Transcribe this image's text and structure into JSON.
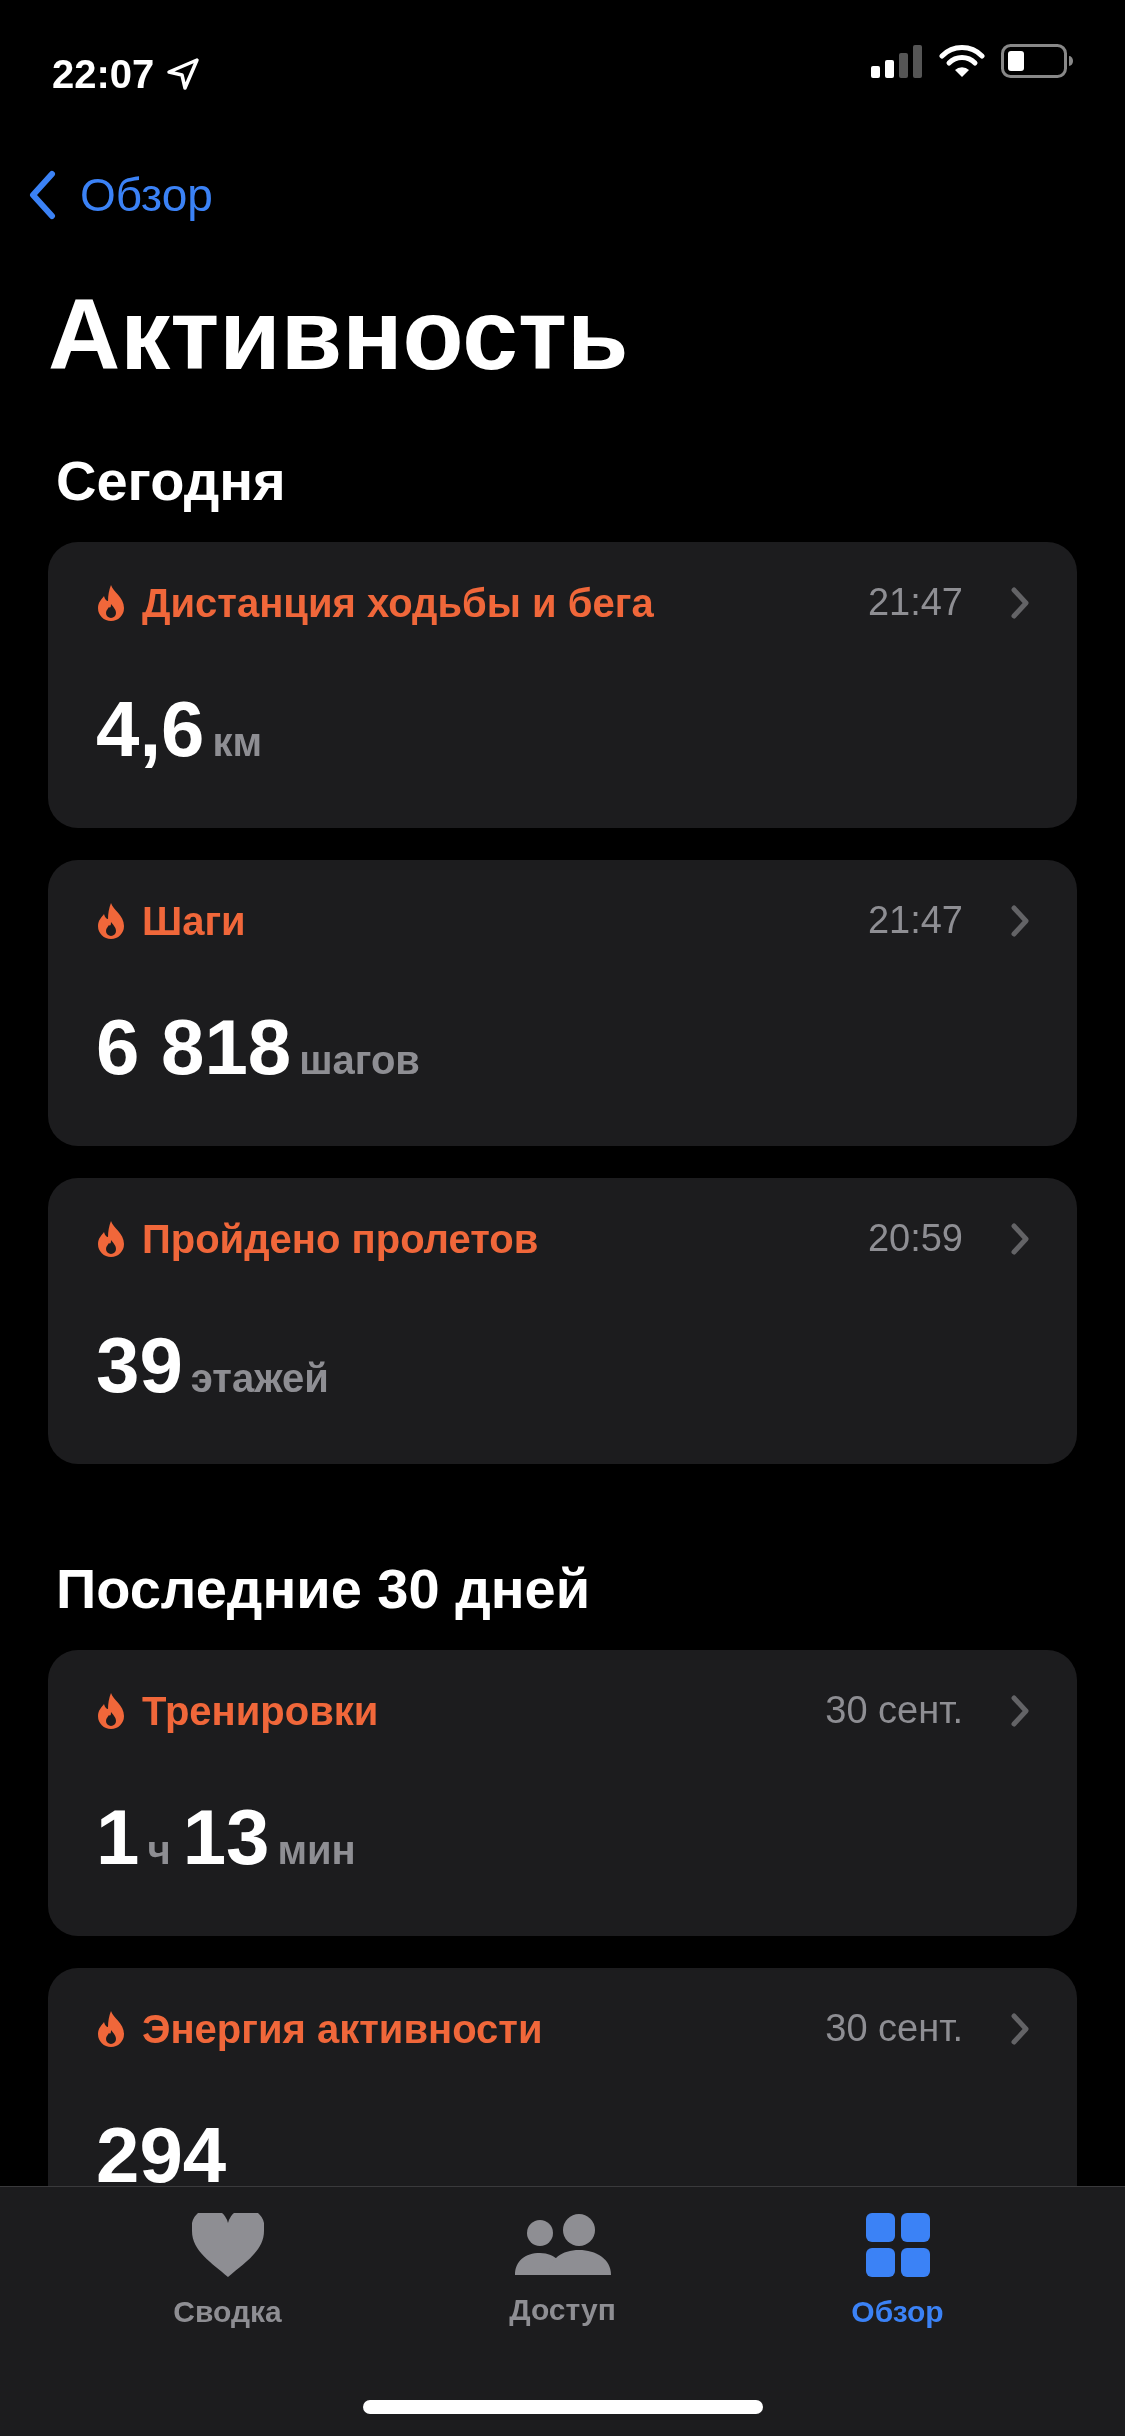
{
  "status_bar": {
    "time": "22:07"
  },
  "nav": {
    "back_label": "Обзор"
  },
  "title": "Активность",
  "sections": [
    {
      "heading": "Сегодня",
      "cards": [
        {
          "title": "Дистанция ходьбы и бега",
          "time": "21:47",
          "value": [
            {
              "kind": "number",
              "text": "4,6"
            },
            {
              "kind": "unit",
              "text": "км"
            }
          ]
        },
        {
          "title": "Шаги",
          "time": "21:47",
          "value": [
            {
              "kind": "number",
              "text": "6 818"
            },
            {
              "kind": "unit",
              "text": "шагов"
            }
          ]
        },
        {
          "title": "Пройдено пролетов",
          "time": "20:59",
          "value": [
            {
              "kind": "number",
              "text": "39"
            },
            {
              "kind": "unit",
              "text": "этажей"
            }
          ]
        }
      ]
    },
    {
      "heading": "Последние 30 дней",
      "cards": [
        {
          "title": "Тренировки",
          "time": "30 сент.",
          "value": [
            {
              "kind": "number",
              "text": "1"
            },
            {
              "kind": "unit",
              "text": "ч"
            },
            {
              "kind": "number",
              "text": "13"
            },
            {
              "kind": "unit",
              "text": "мин"
            }
          ]
        },
        {
          "title": "Энергия активности",
          "time": "30 сент.",
          "value": [
            {
              "kind": "number",
              "text": "294"
            }
          ]
        }
      ]
    }
  ],
  "tab_bar": [
    {
      "kind": "heart",
      "label": "Сводка",
      "selected": false
    },
    {
      "kind": "people",
      "label": "Доступ",
      "selected": false
    },
    {
      "kind": "grid",
      "label": "Обзор",
      "selected": true
    }
  ]
}
